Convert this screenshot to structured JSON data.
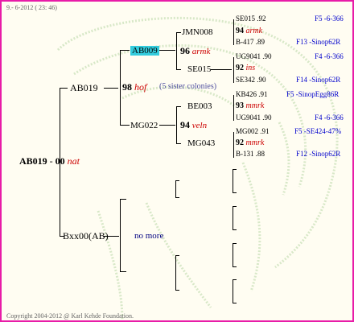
{
  "header": {
    "timestamp": "9.- 6-2012 ( 23: 46)"
  },
  "root": {
    "name": "AB019",
    "score": "00",
    "tag": "nat"
  },
  "gen1": {
    "father": {
      "name": "AB019"
    },
    "mother": {
      "name": "Bxx00(AB)",
      "note": "no more"
    }
  },
  "gen2": {
    "score": "98",
    "tag": "hof",
    "note": "(5 sister colonies)",
    "father": {
      "name": "AB009"
    },
    "mother": {
      "name": "MG022"
    }
  },
  "gen3": {
    "top": {
      "score": "96",
      "tag": "armk",
      "father": "JMN008",
      "mother": "SE015"
    },
    "bottom": {
      "score": "94",
      "tag": "veln",
      "father": "BE003",
      "mother": "MG043"
    }
  },
  "gen4": [
    {
      "score": "94",
      "tag": "armk",
      "father": "SE015 .92",
      "father_ref": "F5 -6-366",
      "mother": "B-417 .89",
      "mother_ref": "F13 -Sinop62R"
    },
    {
      "score": "92",
      "tag": "ins",
      "father": "UG9041 .90",
      "father_ref": "F4 -6-366",
      "mother": "SE342 .90",
      "mother_ref": "F14 -Sinop62R"
    },
    {
      "score": "93",
      "tag": "mmrk",
      "father": "KB426 .91",
      "father_ref": "F5 -SinopEgg86R",
      "mother": "UG9041 .90",
      "mother_ref": "F4 -6-366"
    },
    {
      "score": "92",
      "tag": "mmrk",
      "father": "MG002 .91",
      "father_ref": "F5 -SE424-47%",
      "mother": "B-131 .88",
      "mother_ref": "F12 -Sinop62R"
    }
  ],
  "footer": {
    "copyright": "Copyright 2004-2012 @ Karl Kehde Foundation."
  }
}
